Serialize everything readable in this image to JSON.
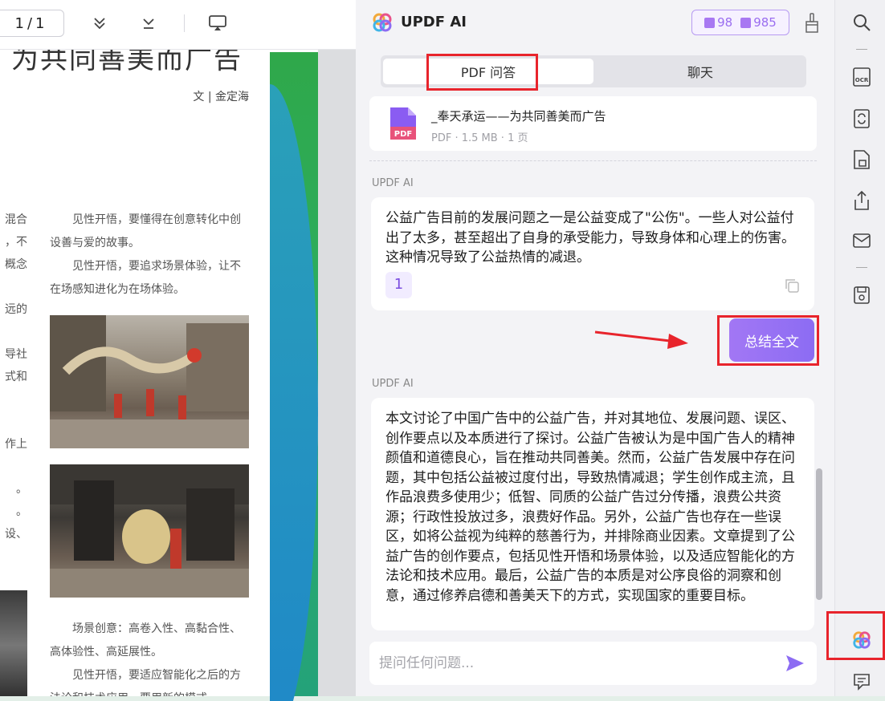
{
  "toolbar": {
    "page_current": "1",
    "page_sep": "/",
    "page_total": "1",
    "icons": [
      "chevrons-down-icon",
      "scroll-to-end-icon",
      "presentation-icon"
    ]
  },
  "document": {
    "title": "为共同善美而广告",
    "author": "文 | 金定海",
    "left_col_lines": [
      "混合",
      "，不",
      "概念",
      "",
      "远的",
      "",
      "导社",
      "式和",
      "",
      "",
      "作上",
      "",
      "。",
      "。",
      "设、"
    ],
    "right_col_top": [
      "见性开悟，要懂得在创意转化中创设善与爱的故事。",
      "见性开悟，要追求场景体验，让不在场感知进化为在场体验。"
    ],
    "right_col_bottom": [
      "场景创意：高卷入性、高黏合性、高体验性、高延展性。",
      "见性开悟，要适应智能化之后的方法论和技术应用，要用新的模式"
    ]
  },
  "ai": {
    "title": "UPDF AI",
    "quota_doc": "98",
    "quota_chat": "985",
    "tabs": {
      "qa": "PDF 问答",
      "chat": "聊天"
    },
    "file": {
      "name": "_奉天承运——为共同善美而广告",
      "meta": "PDF · 1.5 MB · 1 页",
      "badge": "PDF"
    },
    "sender": "UPDF AI",
    "answer1": "公益广告目前的发展问题之一是公益变成了\"公伤\"。一些人对公益付出了太多，甚至超出了自身的承受能力，导致身体和心理上的伤害。这种情况导致了公益热情的减退。",
    "answer1_ref": "1",
    "summary_button": "总结全文",
    "answer2": "本文讨论了中国广告中的公益广告，并对其地位、发展问题、误区、创作要点以及本质进行了探讨。公益广告被认为是中国广告人的精神颜值和道德良心，旨在推动共同善美。然而，公益广告发展中存在问题，其中包括公益被过度付出，导致热情减退；学生创作成主流，且作品浪费多使用少；低智、同质的公益广告过分传播，浪费公共资源；行政性投放过多，浪费好作品。另外，公益广告也存在一些误区，如将公益视为纯粹的慈善行为，并排除商业因素。文章提到了公益广告的创作要点，包括见性开悟和场景体验，以及适应智能化的方法论和技术应用。最后，公益广告的本质是对公序良俗的洞察和创意，通过修养启德和善美天下的方式，实现国家的重要目标。",
    "input_placeholder": "提问任何问题..."
  },
  "sidebar": {
    "icons": [
      "search-icon",
      "ocr-icon",
      "convert-icon",
      "protect-icon",
      "share-icon",
      "email-icon",
      "save-icon",
      "updf-ai-icon",
      "comment-icon"
    ]
  },
  "colors": {
    "accent": "#8c6cf3",
    "highlight": "#e8242c",
    "band_green": "#2fa84a"
  }
}
